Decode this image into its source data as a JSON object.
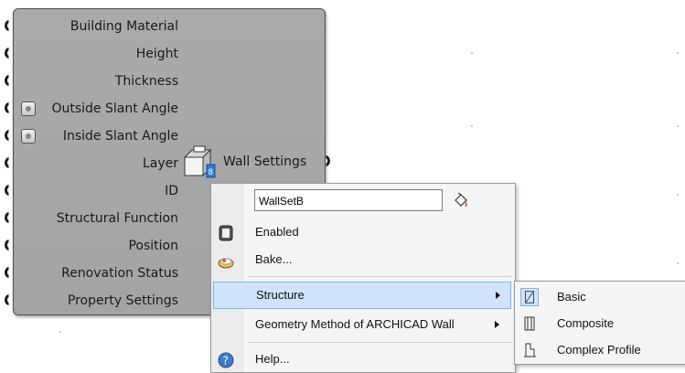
{
  "component": {
    "inputs": [
      {
        "label": "Building Material",
        "slider": false
      },
      {
        "label": "Height",
        "slider": false
      },
      {
        "label": "Thickness",
        "slider": false
      },
      {
        "label": "Outside Slant Angle",
        "slider": true
      },
      {
        "label": "Inside Slant Angle",
        "slider": true
      },
      {
        "label": "Layer",
        "slider": false
      },
      {
        "label": "ID",
        "slider": false
      },
      {
        "label": "Structural Function",
        "slider": false
      },
      {
        "label": "Position",
        "slider": false
      },
      {
        "label": "Renovation Status",
        "slider": false
      },
      {
        "label": "Property Settings",
        "slider": false
      }
    ],
    "output_label": "Wall Settings",
    "icon": "wall-settings-icon"
  },
  "context_menu": {
    "name_value": "WallSetB",
    "items": {
      "enabled": "Enabled",
      "bake": "Bake...",
      "structure": "Structure",
      "geometry_method": "Geometry Method of ARCHICAD Wall",
      "help": "Help..."
    }
  },
  "submenu": {
    "items": {
      "basic": "Basic",
      "composite": "Composite",
      "complex_profile": "Complex Profile"
    },
    "selected": "Basic"
  },
  "colors": {
    "component_fill": "#a8a8a8",
    "highlight": "#cfe4fb",
    "highlight_border": "#7eb4ea"
  }
}
